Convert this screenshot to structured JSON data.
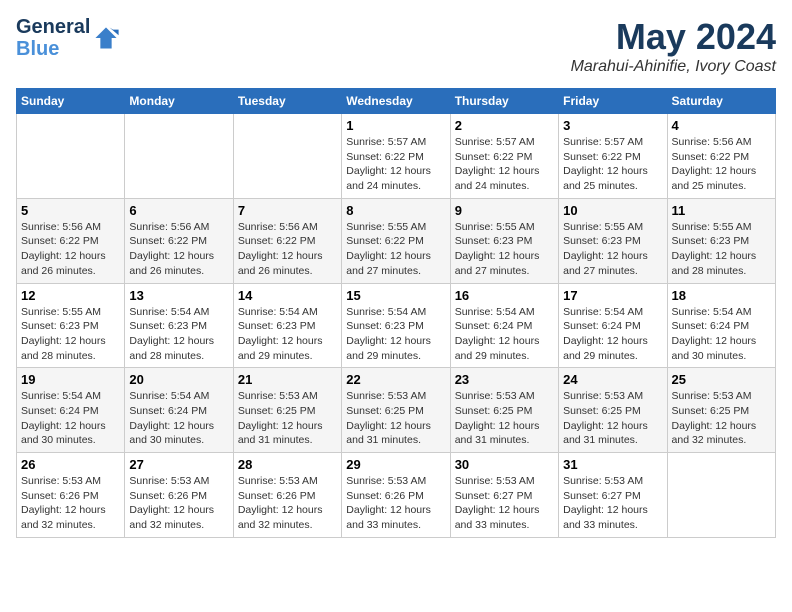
{
  "header": {
    "logo_line1": "General",
    "logo_line2": "Blue",
    "main_title": "May 2024",
    "subtitle": "Marahui-Ahinifie, Ivory Coast"
  },
  "calendar": {
    "days_of_week": [
      "Sunday",
      "Monday",
      "Tuesday",
      "Wednesday",
      "Thursday",
      "Friday",
      "Saturday"
    ],
    "weeks": [
      [
        {
          "day": "",
          "info": ""
        },
        {
          "day": "",
          "info": ""
        },
        {
          "day": "",
          "info": ""
        },
        {
          "day": "1",
          "info": "Sunrise: 5:57 AM\nSunset: 6:22 PM\nDaylight: 12 hours\nand 24 minutes."
        },
        {
          "day": "2",
          "info": "Sunrise: 5:57 AM\nSunset: 6:22 PM\nDaylight: 12 hours\nand 24 minutes."
        },
        {
          "day": "3",
          "info": "Sunrise: 5:57 AM\nSunset: 6:22 PM\nDaylight: 12 hours\nand 25 minutes."
        },
        {
          "day": "4",
          "info": "Sunrise: 5:56 AM\nSunset: 6:22 PM\nDaylight: 12 hours\nand 25 minutes."
        }
      ],
      [
        {
          "day": "5",
          "info": "Sunrise: 5:56 AM\nSunset: 6:22 PM\nDaylight: 12 hours\nand 26 minutes."
        },
        {
          "day": "6",
          "info": "Sunrise: 5:56 AM\nSunset: 6:22 PM\nDaylight: 12 hours\nand 26 minutes."
        },
        {
          "day": "7",
          "info": "Sunrise: 5:56 AM\nSunset: 6:22 PM\nDaylight: 12 hours\nand 26 minutes."
        },
        {
          "day": "8",
          "info": "Sunrise: 5:55 AM\nSunset: 6:22 PM\nDaylight: 12 hours\nand 27 minutes."
        },
        {
          "day": "9",
          "info": "Sunrise: 5:55 AM\nSunset: 6:23 PM\nDaylight: 12 hours\nand 27 minutes."
        },
        {
          "day": "10",
          "info": "Sunrise: 5:55 AM\nSunset: 6:23 PM\nDaylight: 12 hours\nand 27 minutes."
        },
        {
          "day": "11",
          "info": "Sunrise: 5:55 AM\nSunset: 6:23 PM\nDaylight: 12 hours\nand 28 minutes."
        }
      ],
      [
        {
          "day": "12",
          "info": "Sunrise: 5:55 AM\nSunset: 6:23 PM\nDaylight: 12 hours\nand 28 minutes."
        },
        {
          "day": "13",
          "info": "Sunrise: 5:54 AM\nSunset: 6:23 PM\nDaylight: 12 hours\nand 28 minutes."
        },
        {
          "day": "14",
          "info": "Sunrise: 5:54 AM\nSunset: 6:23 PM\nDaylight: 12 hours\nand 29 minutes."
        },
        {
          "day": "15",
          "info": "Sunrise: 5:54 AM\nSunset: 6:23 PM\nDaylight: 12 hours\nand 29 minutes."
        },
        {
          "day": "16",
          "info": "Sunrise: 5:54 AM\nSunset: 6:24 PM\nDaylight: 12 hours\nand 29 minutes."
        },
        {
          "day": "17",
          "info": "Sunrise: 5:54 AM\nSunset: 6:24 PM\nDaylight: 12 hours\nand 29 minutes."
        },
        {
          "day": "18",
          "info": "Sunrise: 5:54 AM\nSunset: 6:24 PM\nDaylight: 12 hours\nand 30 minutes."
        }
      ],
      [
        {
          "day": "19",
          "info": "Sunrise: 5:54 AM\nSunset: 6:24 PM\nDaylight: 12 hours\nand 30 minutes."
        },
        {
          "day": "20",
          "info": "Sunrise: 5:54 AM\nSunset: 6:24 PM\nDaylight: 12 hours\nand 30 minutes."
        },
        {
          "day": "21",
          "info": "Sunrise: 5:53 AM\nSunset: 6:25 PM\nDaylight: 12 hours\nand 31 minutes."
        },
        {
          "day": "22",
          "info": "Sunrise: 5:53 AM\nSunset: 6:25 PM\nDaylight: 12 hours\nand 31 minutes."
        },
        {
          "day": "23",
          "info": "Sunrise: 5:53 AM\nSunset: 6:25 PM\nDaylight: 12 hours\nand 31 minutes."
        },
        {
          "day": "24",
          "info": "Sunrise: 5:53 AM\nSunset: 6:25 PM\nDaylight: 12 hours\nand 31 minutes."
        },
        {
          "day": "25",
          "info": "Sunrise: 5:53 AM\nSunset: 6:25 PM\nDaylight: 12 hours\nand 32 minutes."
        }
      ],
      [
        {
          "day": "26",
          "info": "Sunrise: 5:53 AM\nSunset: 6:26 PM\nDaylight: 12 hours\nand 32 minutes."
        },
        {
          "day": "27",
          "info": "Sunrise: 5:53 AM\nSunset: 6:26 PM\nDaylight: 12 hours\nand 32 minutes."
        },
        {
          "day": "28",
          "info": "Sunrise: 5:53 AM\nSunset: 6:26 PM\nDaylight: 12 hours\nand 32 minutes."
        },
        {
          "day": "29",
          "info": "Sunrise: 5:53 AM\nSunset: 6:26 PM\nDaylight: 12 hours\nand 33 minutes."
        },
        {
          "day": "30",
          "info": "Sunrise: 5:53 AM\nSunset: 6:27 PM\nDaylight: 12 hours\nand 33 minutes."
        },
        {
          "day": "31",
          "info": "Sunrise: 5:53 AM\nSunset: 6:27 PM\nDaylight: 12 hours\nand 33 minutes."
        },
        {
          "day": "",
          "info": ""
        }
      ]
    ]
  }
}
